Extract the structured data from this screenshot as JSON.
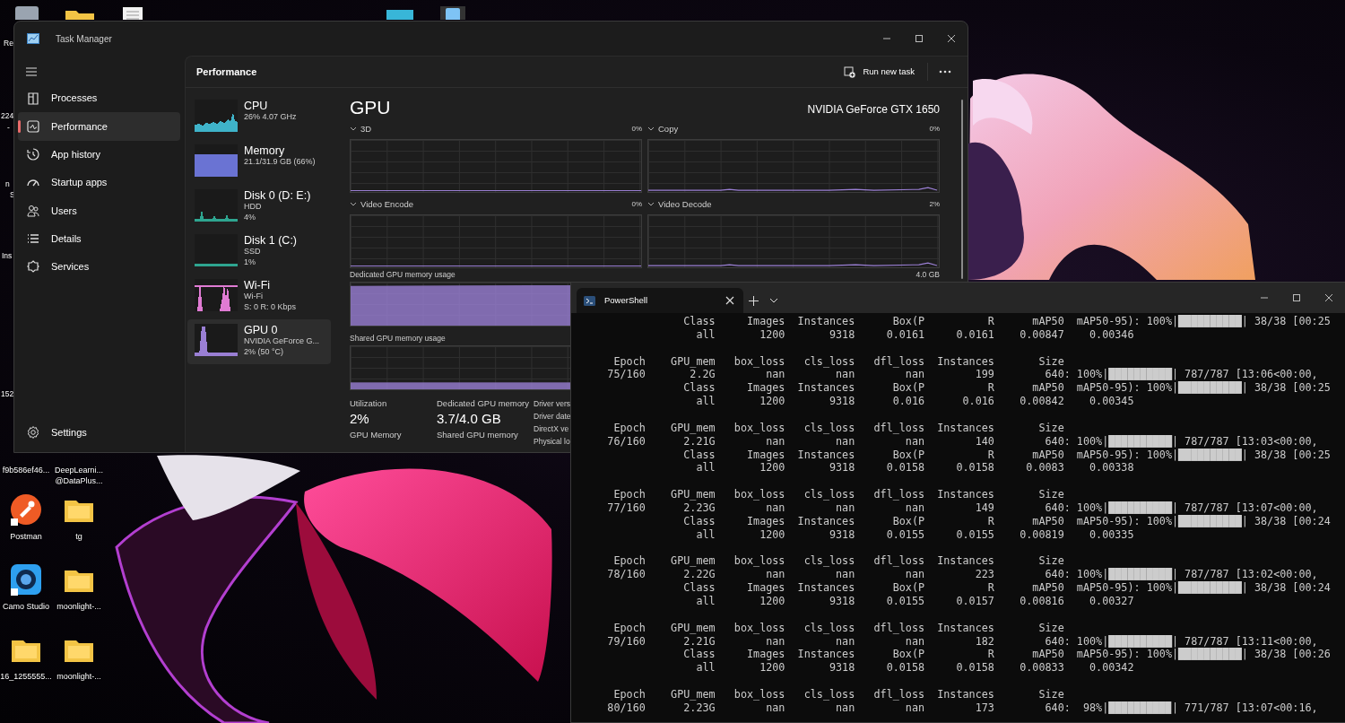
{
  "desktop": {
    "partial_labels": [
      "Re",
      "224",
      "-",
      "n",
      "S",
      "Ins",
      "152"
    ],
    "icons": [
      {
        "label": "f9b586ef46...",
        "kind": "covered"
      },
      {
        "label": "DeepLearni... @DataPlus...",
        "kind": "covered"
      },
      {
        "label": "Postman",
        "kind": "postman"
      },
      {
        "label": "tg",
        "kind": "folder"
      },
      {
        "label": "Camo Studio",
        "kind": "camo"
      },
      {
        "label": "moonlight-...",
        "kind": "folder"
      },
      {
        "label": "16_1255555...",
        "kind": "folder"
      },
      {
        "label": "moonlight-...",
        "kind": "folder"
      }
    ]
  },
  "task_manager": {
    "title": "Task Manager",
    "nav": [
      {
        "label": "Processes",
        "selected": false
      },
      {
        "label": "Performance",
        "selected": true
      },
      {
        "label": "App history",
        "selected": false
      },
      {
        "label": "Startup apps",
        "selected": false
      },
      {
        "label": "Users",
        "selected": false
      },
      {
        "label": "Details",
        "selected": false
      },
      {
        "label": "Services",
        "selected": false
      }
    ],
    "settings": "Settings",
    "header": "Performance",
    "run_new_task": "Run new task",
    "resources": [
      {
        "name": "CPU",
        "lines": [
          "26%  4.07 GHz"
        ],
        "color": "#3fb3c9",
        "selected": false
      },
      {
        "name": "Memory",
        "lines": [
          "21.1/31.9 GB (66%)"
        ],
        "color": "#6a73d3",
        "selected": false
      },
      {
        "name": "Disk 0 (D: E:)",
        "lines": [
          "HDD",
          "4%"
        ],
        "color": "#2ea590",
        "selected": false
      },
      {
        "name": "Disk 1 (C:)",
        "lines": [
          "SSD",
          "1%"
        ],
        "color": "#2ea590",
        "selected": false
      },
      {
        "name": "Wi-Fi",
        "lines": [
          "Wi-Fi",
          "S: 0 R: 0 Kbps"
        ],
        "color": "#e07bd3",
        "selected": false
      },
      {
        "name": "GPU 0",
        "lines": [
          "NVIDIA GeForce G...",
          "2% (50 °C)"
        ],
        "color": "#9a7fd4",
        "selected": true
      }
    ],
    "detail": {
      "title": "GPU",
      "device": "NVIDIA GeForce GTX 1650",
      "engines": [
        {
          "name": "3D",
          "value": "0%"
        },
        {
          "name": "Copy",
          "value": "0%"
        },
        {
          "name": "Video Encode",
          "value": "0%"
        },
        {
          "name": "Video Decode",
          "value": "2%"
        }
      ],
      "dedicated_memory": {
        "label": "Dedicated GPU memory usage",
        "max": "4.0 GB"
      },
      "shared_memory": {
        "label": "Shared GPU memory usage"
      },
      "stats": [
        {
          "label": "Utilization",
          "value": "2%",
          "below": "GPU Memory"
        },
        {
          "label": "Dedicated GPU memory",
          "value": "3.7/4.0 GB",
          "below": "Shared GPU memory"
        }
      ],
      "info_labels": [
        "Driver vers",
        "Driver date",
        "DirectX ve",
        "Physical lo"
      ]
    }
  },
  "powershell": {
    "tab": "PowerShell",
    "output": [
      {
        "lines": [
          "                 Class     Images  Instances      Box(P          R      mAP50  mAP50-95): 100%|██████████| 38/38 [00:25",
          "                   all       1200       9318     0.0161     0.0161    0.00847    0.00346"
        ]
      },
      {
        "lines": [
          "      Epoch    GPU_mem   box_loss   cls_loss   dfl_loss  Instances       Size",
          "     75/160       2.2G        nan        nan        nan        199        640: 100%|██████████| 787/787 [13:06<00:00,",
          "                 Class     Images  Instances      Box(P          R      mAP50  mAP50-95): 100%|██████████| 38/38 [00:25",
          "                   all       1200       9318      0.016      0.016    0.00842    0.00345"
        ]
      },
      {
        "lines": [
          "      Epoch    GPU_mem   box_loss   cls_loss   dfl_loss  Instances       Size",
          "     76/160      2.21G        nan        nan        nan        140        640: 100%|██████████| 787/787 [13:03<00:00,",
          "                 Class     Images  Instances      Box(P          R      mAP50  mAP50-95): 100%|██████████| 38/38 [00:25",
          "                   all       1200       9318     0.0158     0.0158     0.0083    0.00338"
        ]
      },
      {
        "lines": [
          "      Epoch    GPU_mem   box_loss   cls_loss   dfl_loss  Instances       Size",
          "     77/160      2.23G        nan        nan        nan        149        640: 100%|██████████| 787/787 [13:07<00:00,",
          "                 Class     Images  Instances      Box(P          R      mAP50  mAP50-95): 100%|██████████| 38/38 [00:24",
          "                   all       1200       9318     0.0155     0.0155    0.00819    0.00335"
        ]
      },
      {
        "lines": [
          "      Epoch    GPU_mem   box_loss   cls_loss   dfl_loss  Instances       Size",
          "     78/160      2.22G        nan        nan        nan        223        640: 100%|██████████| 787/787 [13:02<00:00,",
          "                 Class     Images  Instances      Box(P          R      mAP50  mAP50-95): 100%|██████████| 38/38 [00:24",
          "                   all       1200       9318     0.0155     0.0157    0.00816    0.00327"
        ]
      },
      {
        "lines": [
          "      Epoch    GPU_mem   box_loss   cls_loss   dfl_loss  Instances       Size",
          "     79/160      2.21G        nan        nan        nan        182        640: 100%|██████████| 787/787 [13:11<00:00,",
          "                 Class     Images  Instances      Box(P          R      mAP50  mAP50-95): 100%|██████████| 38/38 [00:26",
          "                   all       1200       9318     0.0158     0.0158    0.00833    0.00342"
        ]
      },
      {
        "lines": [
          "      Epoch    GPU_mem   box_loss   cls_loss   dfl_loss  Instances       Size",
          "     80/160      2.23G        nan        nan        nan        173        640:  98%|█████████▉| 771/787 [13:07<00:16,"
        ]
      }
    ]
  }
}
